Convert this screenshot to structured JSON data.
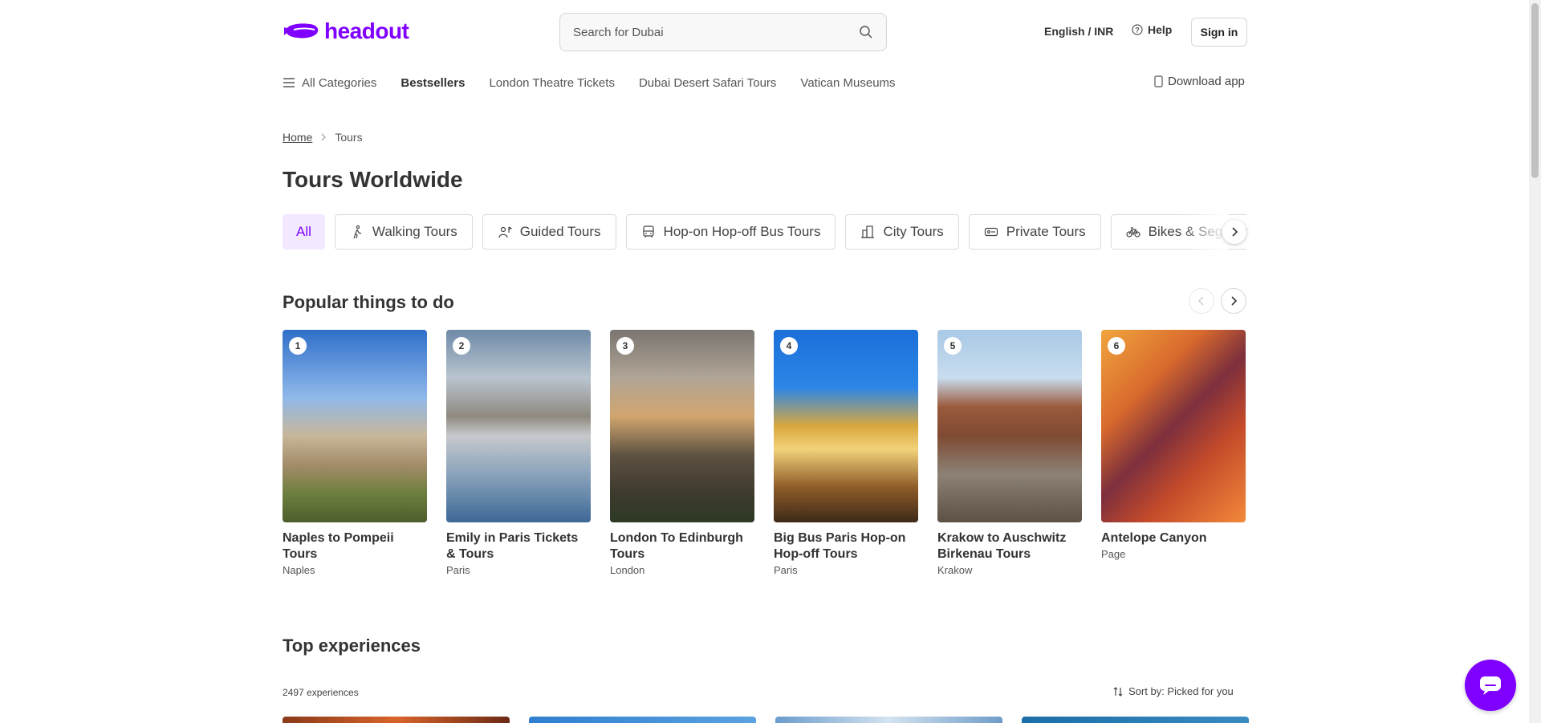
{
  "header": {
    "logo_text": "headout",
    "search_placeholder": "Search for Dubai",
    "language_currency": "English / INR",
    "help_label": "Help",
    "signin_label": "Sign in"
  },
  "category_nav": {
    "all_categories": "All Categories",
    "items": [
      "Bestsellers",
      "London Theatre Tickets",
      "Dubai Desert Safari Tours",
      "Vatican Museums"
    ],
    "download_app": "Download app"
  },
  "breadcrumb": {
    "home": "Home",
    "current": "Tours"
  },
  "page_title": "Tours Worldwide",
  "chips": [
    {
      "label": "All",
      "icon": "none",
      "active": true
    },
    {
      "label": "Walking Tours",
      "icon": "walking-icon"
    },
    {
      "label": "Guided Tours",
      "icon": "guide-icon"
    },
    {
      "label": "Hop-on Hop-off Bus Tours",
      "icon": "bus-icon"
    },
    {
      "label": "City Tours",
      "icon": "city-icon"
    },
    {
      "label": "Private Tours",
      "icon": "ticket-icon"
    },
    {
      "label": "Bikes & Segway",
      "icon": "bike-icon"
    }
  ],
  "popular": {
    "title": "Popular things to do",
    "cards": [
      {
        "rank": "1",
        "title": "Naples to Pompeii Tours",
        "city": "Naples"
      },
      {
        "rank": "2",
        "title": "Emily in Paris Tickets & Tours",
        "city": "Paris"
      },
      {
        "rank": "3",
        "title": "London To Edinburgh Tours",
        "city": "London"
      },
      {
        "rank": "4",
        "title": "Big Bus Paris Hop-on Hop-off Tours",
        "city": "Paris"
      },
      {
        "rank": "5",
        "title": "Krakow to Auschwitz Birkenau Tours",
        "city": "Krakow"
      },
      {
        "rank": "6",
        "title": "Antelope Canyon",
        "city": "Page"
      }
    ]
  },
  "top_experiences": {
    "title": "Top experiences",
    "count": "2497 experiences",
    "sort_label": "Sort by: Picked for you"
  },
  "colors": {
    "brand": "#8000ff",
    "chip_active_bg": "#f3e9ff"
  }
}
